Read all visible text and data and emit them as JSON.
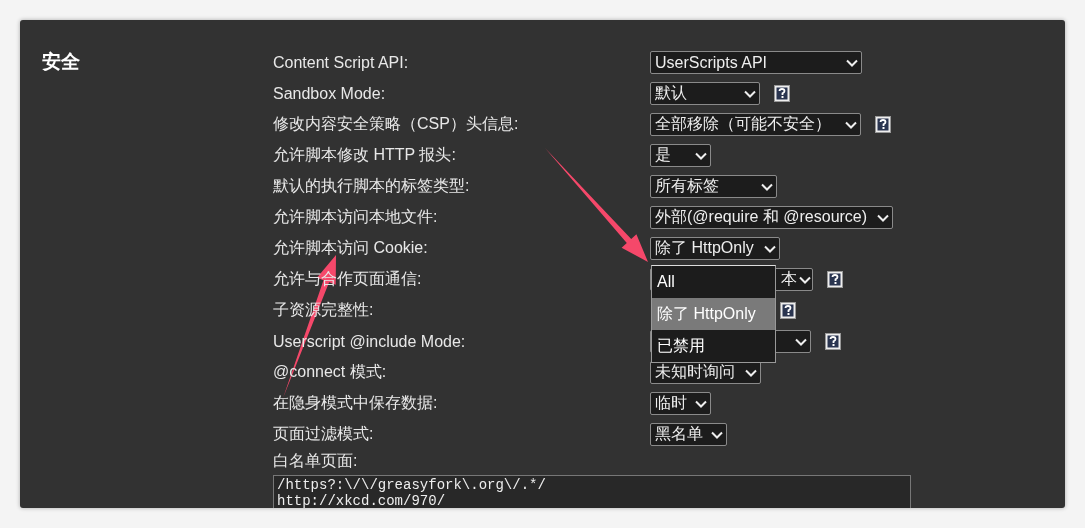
{
  "section": {
    "title": "安全",
    "settings": [
      {
        "label": "Content Script API:",
        "select": {
          "value": "UserScripts API",
          "help": false
        }
      },
      {
        "label": "Sandbox Mode:",
        "select": {
          "value": "默认",
          "help": true
        }
      },
      {
        "label": "修改内容安全策略（CSP）头信息:",
        "select": {
          "value": "全部移除（可能不安全）",
          "help": true
        }
      },
      {
        "label": "允许脚本修改 HTTP 报头:",
        "select": {
          "value": "是",
          "help": false
        }
      },
      {
        "label": "默认的执行脚本的标签类型:",
        "select": {
          "value": "所有标签",
          "help": false
        }
      },
      {
        "label": "允许脚本访问本地文件:",
        "select": {
          "value": "外部(@require 和 @resource)",
          "help": false
        }
      },
      {
        "label": "允许脚本访问 Cookie:",
        "select": {
          "value": "除了 HttpOnly",
          "help": false
        }
      },
      {
        "label": "允许与合作页面通信:",
        "select": {
          "value": "本",
          "help": true
        }
      },
      {
        "label": "子资源完整性:",
        "select": {
          "caret": false,
          "help": true
        }
      },
      {
        "label": "Userscript @include Mode:",
        "select": {
          "help": true
        }
      },
      {
        "label": "@connect 模式:",
        "select": {
          "value": "未知时询问",
          "help": false
        }
      },
      {
        "label": "在隐身模式中保存数据:",
        "select": {
          "value": "临时",
          "help": false
        }
      },
      {
        "label": "页面过滤模式:",
        "select": {
          "value": "黑名单",
          "help": false
        }
      }
    ],
    "whitelist": {
      "label": "白名单页面:",
      "lines": [
        "/https?:\\/\\/greasyfork\\.org\\/.*/",
        "http://xkcd.com/970/"
      ]
    }
  },
  "dropdown": {
    "options": [
      {
        "label": "All",
        "selected": false
      },
      {
        "label": "除了 HttpOnly",
        "selected": true
      },
      {
        "label": "已禁用",
        "selected": false
      }
    ]
  }
}
